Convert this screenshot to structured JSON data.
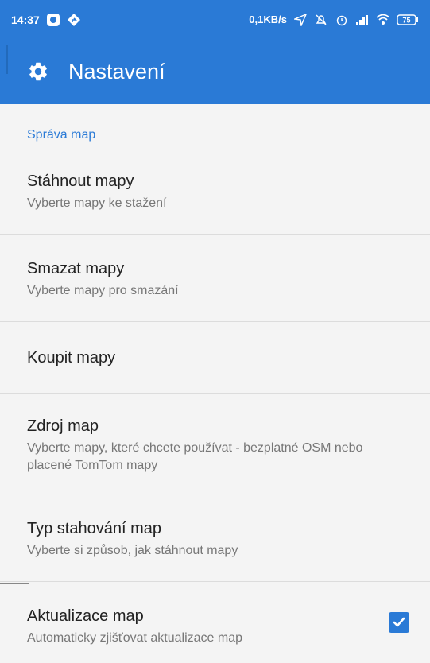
{
  "status_bar": {
    "time": "14:37",
    "speed": "0,1KB/s",
    "battery": "75",
    "icons": [
      "app-icon",
      "navigation-icon",
      "location-arrow-icon",
      "alarm-off-icon",
      "alarm-clock-icon",
      "signal-icon",
      "wifi-icon",
      "battery-icon"
    ]
  },
  "app_bar": {
    "title": "Nastavení",
    "icon": "gear-icon"
  },
  "section": {
    "title": "Správa map"
  },
  "items": [
    {
      "title": "Stáhnout mapy",
      "subtitle": "Vyberte mapy ke stažení"
    },
    {
      "title": "Smazat mapy",
      "subtitle": "Vyberte mapy pro smazání"
    },
    {
      "title": "Koupit mapy",
      "subtitle": ""
    },
    {
      "title": "Zdroj map",
      "subtitle": "Vyberte mapy, které chcete používat - bezplatné OSM nebo placené TomTom mapy"
    },
    {
      "title": "Typ stahování map",
      "subtitle": "Vyberte si způsob, jak stáhnout mapy"
    },
    {
      "title": "Aktualizace map",
      "subtitle": "Automaticky zjišťovat aktualizace map",
      "checked": true
    }
  ],
  "colors": {
    "primary": "#2a7ad6",
    "background": "#f4f4f4",
    "divider": "#dcdcdc",
    "subtitle": "#777777"
  }
}
